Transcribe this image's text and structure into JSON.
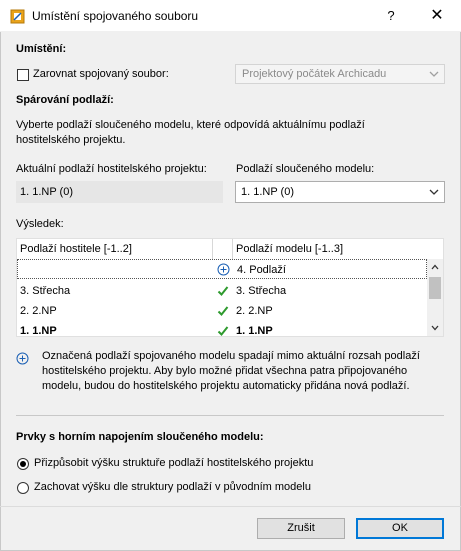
{
  "window": {
    "title": "Umístění spojovaného souboru",
    "help_glyph": "?",
    "close_glyph": "✕"
  },
  "placement": {
    "heading": "Umístění:",
    "align_label": "Zarovnat spojovaný soubor:",
    "align_checked": false,
    "origin_value": "Projektový počátek Archicadu"
  },
  "story_pairing": {
    "heading": "Spárování podlaží:",
    "description": "Vyberte podlaží sloučeného modelu, které odpovídá aktuálnímu podlaží hostitelského projektu.",
    "host_story_label": "Aktuální podlaží hostitelského projektu:",
    "host_story_value": "1. 1.NP (0)",
    "merged_story_label": "Podlaží sloučeného modelu:",
    "merged_story_value": "1. 1.NP (0)"
  },
  "result": {
    "heading": "Výsledek:",
    "col_host": "Podlaží hostitele [-1..2]",
    "col_model": "Podlaží modelu [-1..3]",
    "rows": [
      {
        "host": "",
        "status": "add",
        "model": "4. Podlaží"
      },
      {
        "host": "3. Střecha",
        "status": "check",
        "model": "3. Střecha"
      },
      {
        "host": "2. 2.NP",
        "status": "check",
        "model": "2. 2.NP"
      },
      {
        "host": "1. 1.NP",
        "status": "check",
        "model": "1. 1.NP"
      }
    ],
    "info_text": "Označená podlaží spojovaného modelu spadají mimo aktuální rozsah podlaží hostitelského projektu. Aby bylo možné přidat všechna patra připojovaného modelu, budou do hostitelského projektu automaticky přidána nová podlaží."
  },
  "top_link": {
    "heading": "Prvky s horním napojením sloučeného modelu:",
    "option_fit": "Přizpůsobit výšku struktuře podlaží hostitelského projektu",
    "option_keep": "Zachovat výšku dle struktury podlaží v původním modelu",
    "selected": "fit"
  },
  "buttons": {
    "cancel": "Zrušit",
    "ok": "OK"
  },
  "colors": {
    "accent": "#0078d7",
    "check": "#2e9a2e",
    "add_icon": "#1a5fb4"
  }
}
